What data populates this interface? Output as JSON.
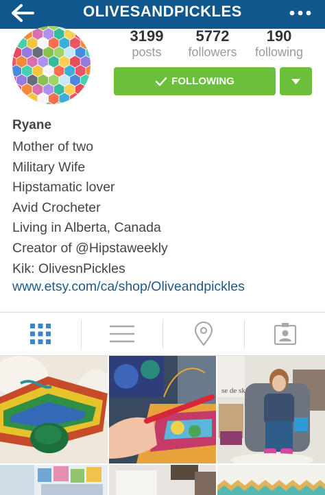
{
  "header": {
    "title": "OLIVESANDPICKLES",
    "back_icon": "back-arrow-icon",
    "more_icon": "more-dots-icon"
  },
  "stats": [
    {
      "value": "3199",
      "label": "posts"
    },
    {
      "value": "5772",
      "label": "followers"
    },
    {
      "value": "190",
      "label": "following"
    }
  ],
  "buttons": {
    "follow_label": "FOLLOWING"
  },
  "profile": {
    "name": "Ryane",
    "bio": [
      "Mother of two",
      "Military Wife",
      "Hipstamatic lover",
      "Avid Crocheter",
      "Living in Alberta, Canada",
      "Creator of @Hipstaweekly",
      "Kik: OlivesnPickles"
    ],
    "website": "www.etsy.com/ca/shop/Oliveandpickles"
  },
  "tabs": [
    {
      "icon": "grid-view-icon",
      "active": true
    },
    {
      "icon": "list-view-icon",
      "active": false
    },
    {
      "icon": "map-pin-icon",
      "active": false
    },
    {
      "icon": "tagged-photos-icon",
      "active": false
    }
  ],
  "photo_tile_text": "se de ski",
  "colors": {
    "header_bg": "#10578e",
    "follow_green": "#6bbf3b",
    "link_blue": "#1d5a8b",
    "active_tab": "#3b86c9",
    "inactive_tab": "#a8a8a8"
  }
}
